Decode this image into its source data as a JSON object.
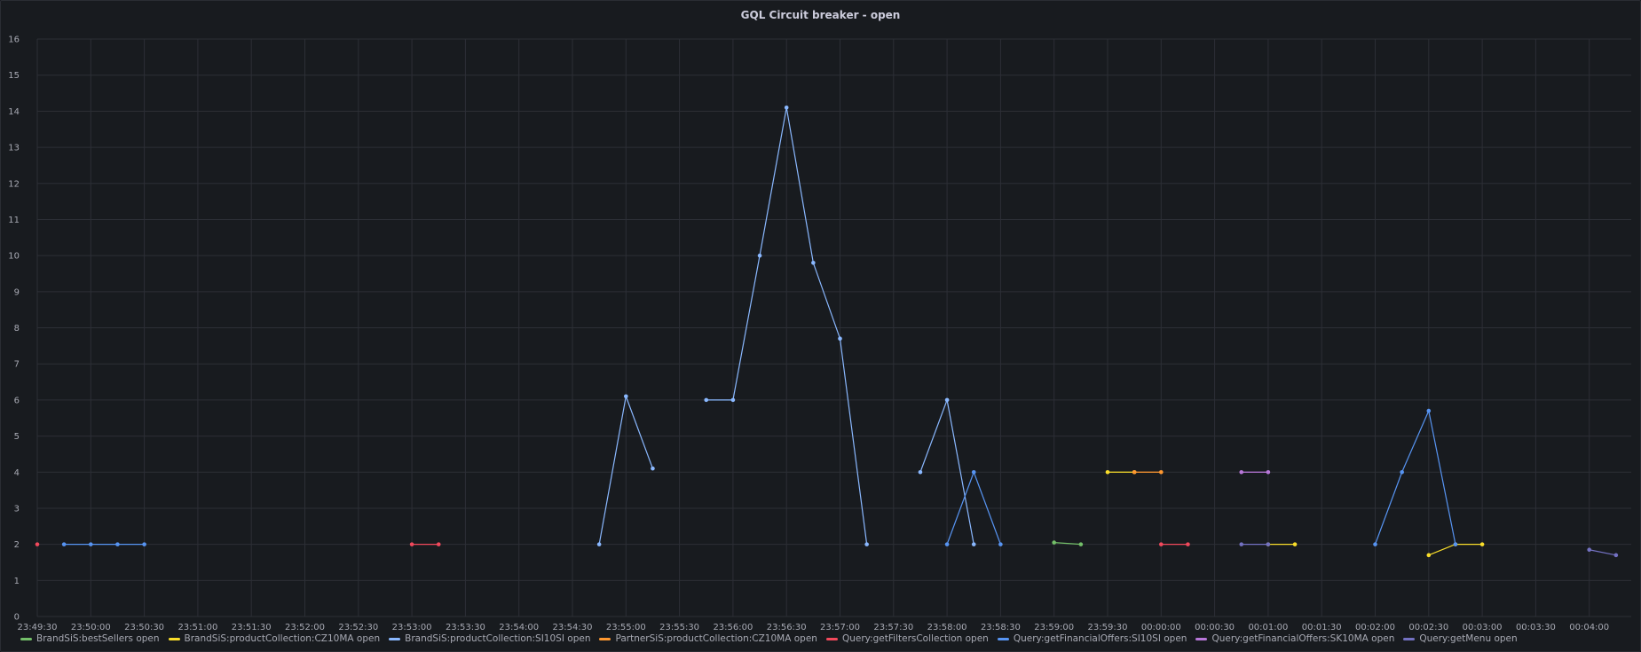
{
  "panel": {
    "title": "GQL Circuit breaker - open"
  },
  "chart_data": {
    "type": "line",
    "title": "GQL Circuit breaker - open",
    "xlabel": "",
    "ylabel": "",
    "ylim": [
      0,
      16
    ],
    "y_ticks": [
      "0",
      "1",
      "2",
      "3",
      "4",
      "5",
      "6",
      "7",
      "8",
      "9",
      "10",
      "11",
      "12",
      "13",
      "14",
      "15",
      "16"
    ],
    "x_tick_labels": [
      "23:49:30",
      "23:50:00",
      "23:50:30",
      "23:51:00",
      "23:51:30",
      "23:52:00",
      "23:52:30",
      "23:53:00",
      "23:53:30",
      "23:54:00",
      "23:54:30",
      "23:55:00",
      "23:55:30",
      "23:56:00",
      "23:56:30",
      "23:57:00",
      "23:57:30",
      "23:58:00",
      "23:58:30",
      "23:59:00",
      "23:59:30",
      "00:00:00",
      "00:00:30",
      "00:01:00",
      "00:01:30",
      "00:02:00",
      "00:02:30",
      "00:03:00",
      "00:03:30",
      "00:04:00"
    ],
    "xlim": [
      "23:49:30",
      "00:04:30"
    ],
    "grid": true,
    "legend_position": "bottom",
    "series": [
      {
        "name": "BrandSiS:bestSellers open",
        "color": "#73bf69",
        "points": [
          [
            "23:59:00",
            2.05
          ],
          [
            "23:59:15",
            2
          ]
        ]
      },
      {
        "name": "BrandSiS:productCollection:CZ10MA open",
        "color": "#fade2a",
        "points": [
          [
            "23:59:30",
            4
          ],
          [
            "23:59:45",
            4
          ],
          [
            "00:01:00",
            2
          ],
          [
            "00:01:15",
            2
          ],
          [
            "00:02:30",
            1.7
          ],
          [
            "00:02:45",
            2
          ],
          [
            "00:03:00",
            2
          ]
        ]
      },
      {
        "name": "BrandSiS:productCollection:SI10SI open",
        "color": "#8ab8ff",
        "points": [
          [
            "23:54:45",
            2
          ],
          [
            "23:55:00",
            6.1
          ],
          [
            "23:55:15",
            4.1
          ],
          [
            "23:55:45",
            6
          ],
          [
            "23:56:00",
            6
          ],
          [
            "23:56:15",
            10
          ],
          [
            "23:56:30",
            14.1
          ],
          [
            "23:56:45",
            9.8
          ],
          [
            "23:57:00",
            7.7
          ],
          [
            "23:57:15",
            2
          ],
          [
            "23:57:45",
            4
          ],
          [
            "23:58:00",
            6
          ],
          [
            "23:58:15",
            2
          ]
        ]
      },
      {
        "name": "PartnerSiS:productCollection:CZ10MA open",
        "color": "#ff9830",
        "points": [
          [
            "23:59:45",
            4
          ],
          [
            "00:00:00",
            4
          ]
        ]
      },
      {
        "name": "Query:getFiltersCollection open",
        "color": "#f2495c",
        "points": [
          [
            "23:49:30",
            2
          ],
          [
            "23:53:00",
            2
          ],
          [
            "23:53:15",
            2
          ],
          [
            "00:00:00",
            2
          ],
          [
            "00:00:15",
            2
          ]
        ]
      },
      {
        "name": "Query:getFinancialOffers:SI10SI open",
        "color": "#5794f2",
        "points": [
          [
            "23:49:45",
            2
          ],
          [
            "23:50:00",
            2
          ],
          [
            "23:50:15",
            2
          ],
          [
            "23:50:30",
            2
          ],
          [
            "23:58:00",
            2
          ],
          [
            "23:58:15",
            4
          ],
          [
            "23:58:30",
            2
          ],
          [
            "00:02:00",
            2
          ],
          [
            "00:02:15",
            4
          ],
          [
            "00:02:30",
            5.7
          ],
          [
            "00:02:45",
            2
          ]
        ]
      },
      {
        "name": "Query:getFinancialOffers:SK10MA open",
        "color": "#b877d9",
        "points": [
          [
            "00:00:45",
            4
          ],
          [
            "00:01:00",
            4
          ]
        ]
      },
      {
        "name": "Query:getMenu open",
        "color": "#7371c2",
        "points": [
          [
            "00:00:45",
            2
          ],
          [
            "00:01:00",
            2
          ],
          [
            "00:04:00",
            1.85
          ],
          [
            "00:04:15",
            1.7
          ]
        ]
      }
    ]
  }
}
